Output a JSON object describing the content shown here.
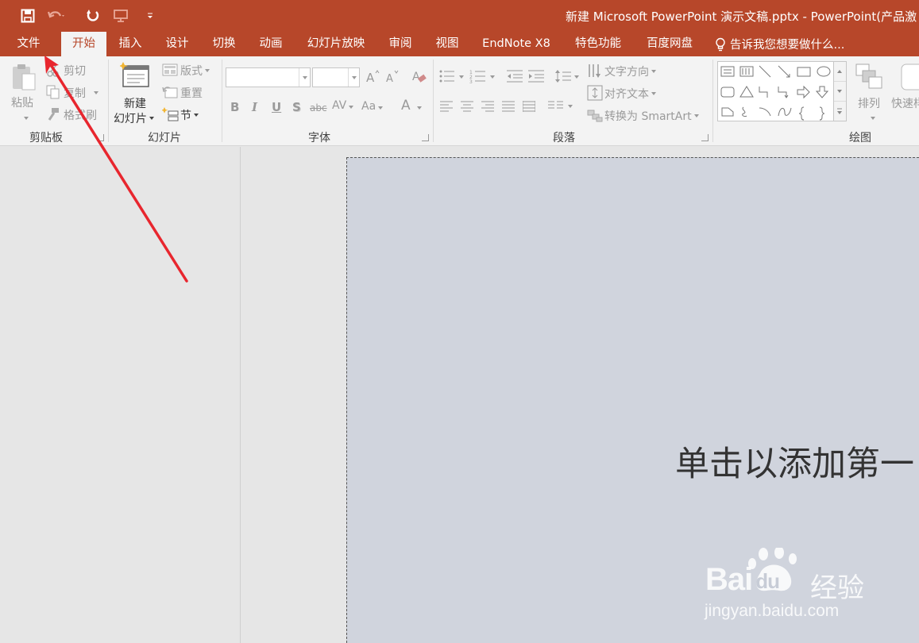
{
  "colors": {
    "accent": "#b7472a",
    "ribbon_bg": "#f3f3f3",
    "slide_bg": "#d0d4dd",
    "arrow": "#e8262e"
  },
  "window": {
    "title": "新建 Microsoft PowerPoint 演示文稿.pptx - PowerPoint(产品激"
  },
  "qat": {
    "icons": [
      "save-icon",
      "undo-icon",
      "redo-icon",
      "present-icon",
      "customize-icon"
    ]
  },
  "tabs": [
    "文件",
    "开始",
    "插入",
    "设计",
    "切换",
    "动画",
    "幻灯片放映",
    "审阅",
    "视图",
    "EndNote X8",
    "特色功能",
    "百度网盘"
  ],
  "active_tab": "开始",
  "tell_me": "告诉我您想要做什么...",
  "ribbon": {
    "clipboard": {
      "label": "剪贴板",
      "paste": "粘贴",
      "cut": "剪切",
      "copy": "复制",
      "format_painter": "格式刷"
    },
    "slides": {
      "label": "幻灯片",
      "new_slide_line1": "新建",
      "new_slide_line2": "幻灯片",
      "layout": "版式",
      "reset": "重置",
      "section": "节"
    },
    "font": {
      "label": "字体",
      "font_name": "",
      "font_size": "",
      "bold": "B",
      "italic": "I",
      "underline": "U",
      "shadow": "S",
      "strike": "abc",
      "spacing": "AV",
      "case": "Aa",
      "color": "A"
    },
    "paragraph": {
      "label": "段落",
      "text_direction": "文字方向",
      "align_text": "对齐文本",
      "smartart": "转换为 SmartArt"
    },
    "drawing": {
      "label": "绘图",
      "arrange": "排列",
      "quick_styles": "快速样"
    }
  },
  "slide": {
    "title_placeholder": "单击以添加第一"
  },
  "watermark": {
    "brand": "Bai",
    "brand_du": "du",
    "cn": "经验",
    "url": "jingyan.baidu.com"
  }
}
